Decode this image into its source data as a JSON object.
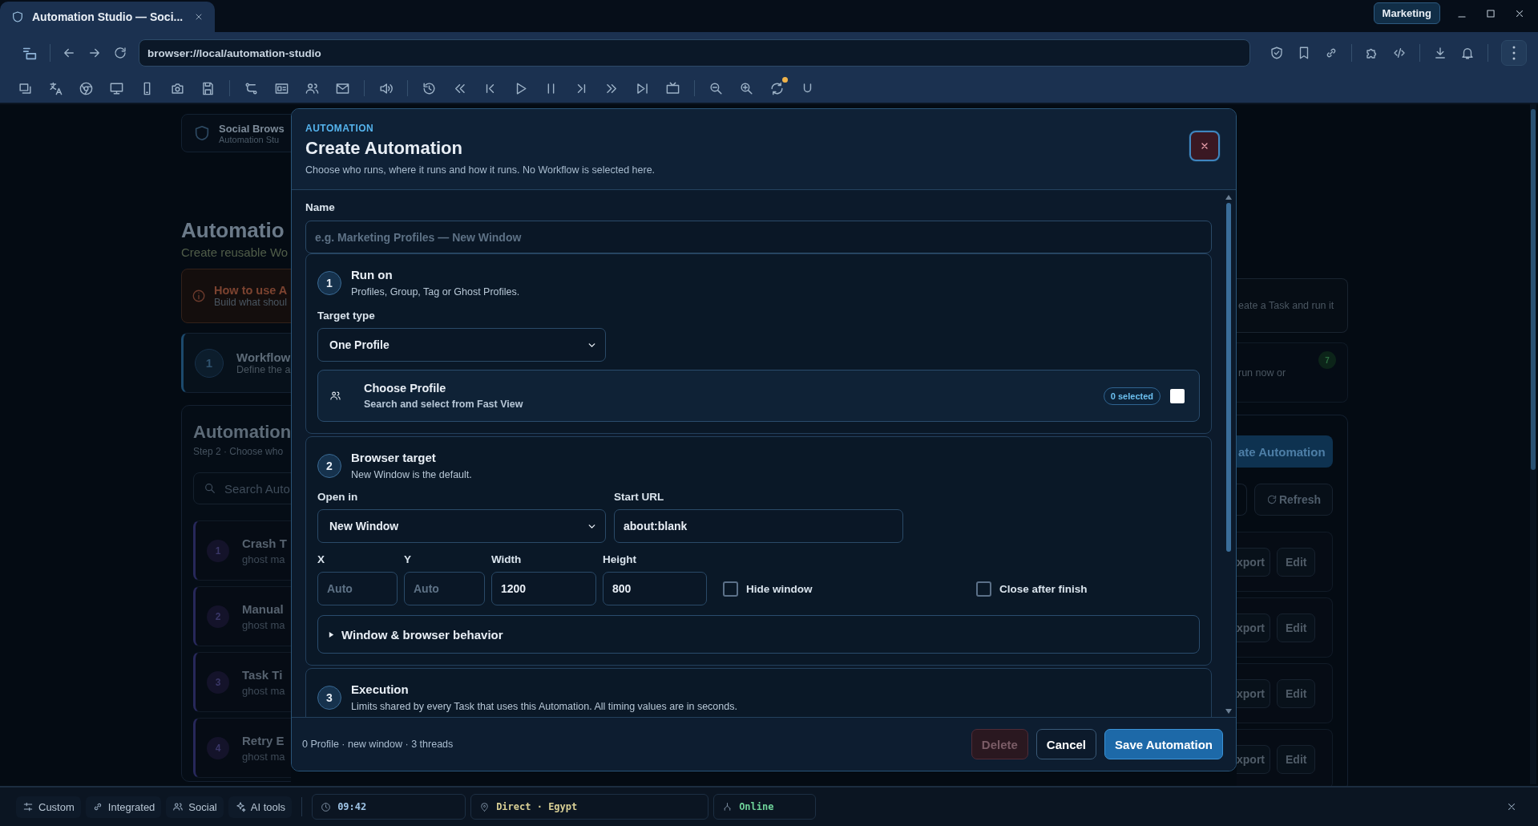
{
  "browser_tab": {
    "title": "Automation Studio — Soci...",
    "selected": true
  },
  "profile_badge": "Marketing",
  "address_bar": {
    "url": "browser://local/automation-studio"
  },
  "toolbar": {
    "sync_badge": true
  },
  "page": {
    "header": {
      "title": "Social Brows",
      "subtitle": "Automation Stu"
    },
    "heading": "Automatio",
    "subheading": "Create reusable Wo",
    "howto": {
      "title": "How to use A",
      "text": "Build what shoul",
      "text_right": "eate a Task and run it"
    },
    "workflow": {
      "number": "1",
      "title": "Workflow",
      "text": "Define the a",
      "text_right": "run now or",
      "count": "7"
    },
    "panel": {
      "title": "Automation",
      "subtitle": "Step 2 · Choose who",
      "search_placeholder": "Search Auto",
      "create_button": "ate Automation",
      "refresh_button": "Refresh",
      "rows": [
        {
          "number": "1",
          "title": "Crash T",
          "meta": "ghost ma",
          "export": "xport",
          "edit": "Edit"
        },
        {
          "number": "2",
          "title": "Manual",
          "meta": "ghost ma",
          "export": "xport",
          "edit": "Edit"
        },
        {
          "number": "3",
          "title": "Task Ti",
          "meta": "ghost ma",
          "export": "xport",
          "edit": "Edit"
        },
        {
          "number": "4",
          "title": "Retry E",
          "meta": "ghost ma",
          "export": "xport",
          "edit": "Edit"
        }
      ]
    }
  },
  "dialog": {
    "eyebrow": "AUTOMATION",
    "title": "Create Automation",
    "description": "Choose who runs, where it runs and how it runs. No Workflow is selected here.",
    "name": {
      "label": "Name",
      "placeholder": "e.g. Marketing Profiles — New Window"
    },
    "run_on": {
      "number": "1",
      "title": "Run on",
      "subtitle": "Profiles, Group, Tag or Ghost Profiles.",
      "target_type": {
        "label": "Target type",
        "value": "One Profile"
      },
      "choose_profile": {
        "title": "Choose Profile",
        "subtitle": "Search and select from Fast View",
        "count": "0 selected",
        "checked": false
      }
    },
    "browser_target": {
      "number": "2",
      "title": "Browser target",
      "subtitle": "New Window is the default.",
      "open_in": {
        "label": "Open in",
        "value": "New Window"
      },
      "start_url": {
        "label": "Start URL",
        "value": "about:blank"
      },
      "geometry": [
        {
          "label": "X",
          "placeholder": "Auto"
        },
        {
          "label": "Y",
          "placeholder": "Auto"
        },
        {
          "label": "Width",
          "value": "1200"
        },
        {
          "label": "Height",
          "value": "800"
        }
      ],
      "options": [
        {
          "label": "Hide window",
          "checked": false
        },
        {
          "label": "Close after finish",
          "checked": false
        }
      ],
      "behavior": {
        "label": "Window & browser behavior",
        "expanded": false
      }
    },
    "execution": {
      "number": "3",
      "title": "Execution",
      "subtitle": "Limits shared by every Task that uses this Automation. All timing values are in seconds."
    },
    "footer": {
      "summary": "0 Profile · new window · 3 threads",
      "buttons": [
        {
          "label": "Delete",
          "kind": "danger",
          "disabled": true
        },
        {
          "label": "Cancel",
          "kind": "secondary",
          "disabled": false
        },
        {
          "label": "Save Automation",
          "kind": "primary",
          "disabled": false
        }
      ]
    }
  },
  "status_bar": {
    "modes": [
      {
        "label": "Custom"
      },
      {
        "label": "Integrated"
      },
      {
        "label": "Social"
      },
      {
        "label": "AI tools"
      }
    ],
    "clock": "09:42",
    "route": "Direct · Egypt",
    "connection": "Online"
  }
}
